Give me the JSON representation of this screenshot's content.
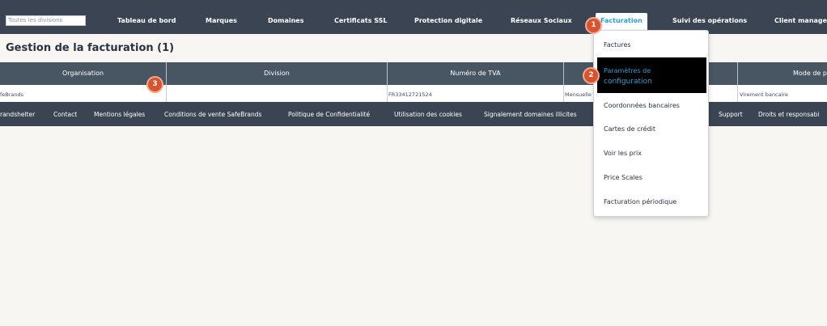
{
  "nav": {
    "division_select": "Toutes les divisions",
    "items": [
      "Tableau de bord",
      "Marques",
      "Domaines",
      "Certificats SSL",
      "Protection digitale",
      "Réseaux Sociaux",
      "Facturation",
      "Suivi des opérations",
      "Client manage"
    ],
    "active": "Facturation"
  },
  "page": {
    "title": "Gestion de la facturation  (1)"
  },
  "table": {
    "columns": [
      "Organisation",
      "Division",
      "Numéro de TVA",
      "",
      "",
      "Mode de p"
    ],
    "row": [
      "feBrands",
      "",
      "FR33412721524",
      "Mensuelle",
      "",
      "Virement bancaire"
    ]
  },
  "footer": {
    "links": [
      "randshelter",
      "Contact",
      "Mentions légales",
      "Conditions de vente SafeBrands",
      "Politique de Confidentialité",
      "Utilisation des cookies",
      "Signalement domaines illicites",
      "Support",
      "Droits et responsabi"
    ]
  },
  "dropdown": {
    "items": [
      "Factures",
      "Paramètres de configuration",
      "Coordonnées bancaires",
      "Cartes de crédit",
      "Voir les prix",
      "Price Scales",
      "Facturation périodique"
    ],
    "highlighted": "Paramètres de configuration",
    "highlight_line1": "Paramètres de",
    "highlight_line2": "configuration"
  },
  "badges": [
    "1",
    "2",
    "3"
  ],
  "colors": {
    "nav_bg": "#3a4452",
    "header_bg": "#485563",
    "accent": "#2a9fd6",
    "badge": "#d9532e"
  }
}
